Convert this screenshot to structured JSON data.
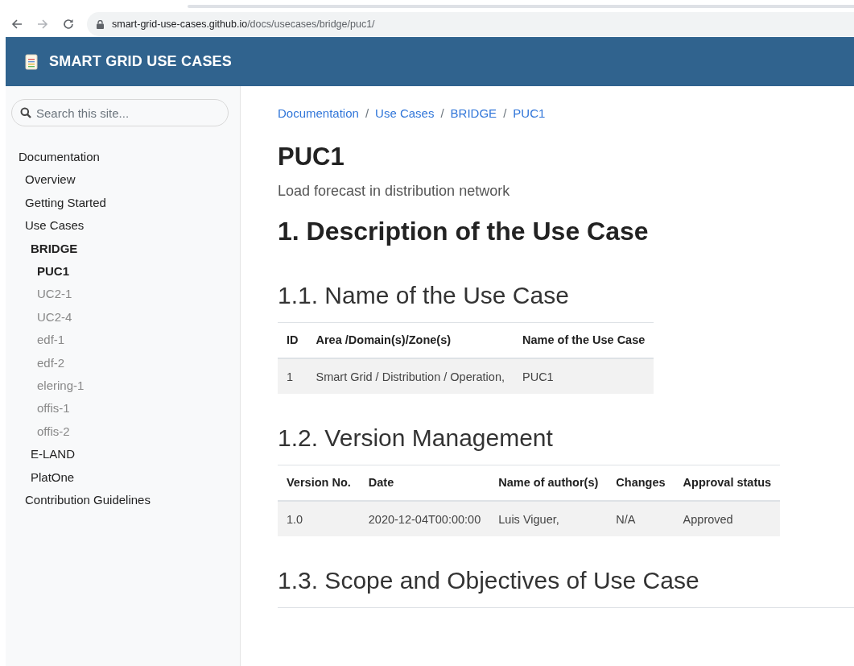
{
  "browser": {
    "url_host": "smart-grid-use-cases.github.io",
    "url_path": "/docs/usecases/bridge/puc1/"
  },
  "header": {
    "title": "SMART GRID USE CASES"
  },
  "sidebar": {
    "search": {
      "placeholder": "Search this site..."
    },
    "items": [
      {
        "label": "Documentation",
        "active": false,
        "children": [
          {
            "label": "Overview",
            "active": false
          },
          {
            "label": "Getting Started",
            "active": false
          },
          {
            "label": "Use Cases",
            "active": false,
            "children": [
              {
                "label": "BRIDGE",
                "active": true,
                "children": [
                  {
                    "label": "PUC1",
                    "active": true
                  },
                  {
                    "label": "UC2-1",
                    "active": false
                  },
                  {
                    "label": "UC2-4",
                    "active": false
                  },
                  {
                    "label": "edf-1",
                    "active": false
                  },
                  {
                    "label": "edf-2",
                    "active": false
                  },
                  {
                    "label": "elering-1",
                    "active": false
                  },
                  {
                    "label": "offis-1",
                    "active": false
                  },
                  {
                    "label": "offis-2",
                    "active": false
                  }
                ]
              },
              {
                "label": "E-LAND",
                "active": false
              },
              {
                "label": "PlatOne",
                "active": false
              }
            ]
          },
          {
            "label": "Contribution Guidelines",
            "active": false
          }
        ]
      }
    ]
  },
  "breadcrumb": {
    "separator": "/",
    "items": [
      "Documentation",
      "Use Cases",
      "BRIDGE",
      "PUC1"
    ]
  },
  "content": [
    {
      "kind": "title",
      "text": "PUC1"
    },
    {
      "kind": "lead",
      "text": "Load forecast in distribution network"
    },
    {
      "kind": "h1",
      "text": "1. Description of the Use Case"
    },
    {
      "kind": "h2",
      "text": "1.1. Name of the Use Case"
    },
    {
      "kind": "table",
      "columns": [
        "ID",
        "Area /Domain(s)/Zone(s)",
        "Name of the Use Case"
      ],
      "rows": [
        [
          "1",
          "Smart Grid / Distribution / Operation,",
          "PUC1"
        ]
      ]
    },
    {
      "kind": "h2",
      "text": "1.2. Version Management"
    },
    {
      "kind": "table",
      "columns": [
        "Version No.",
        "Date",
        "Name of author(s)",
        "Changes",
        "Approval status"
      ],
      "rows": [
        [
          "1.0",
          "2020-12-04T00:00:00",
          "Luis Viguer,",
          "N/A",
          "Approved"
        ]
      ]
    },
    {
      "kind": "h2",
      "text": "1.3. Scope and Objectives of Use Case"
    }
  ]
}
